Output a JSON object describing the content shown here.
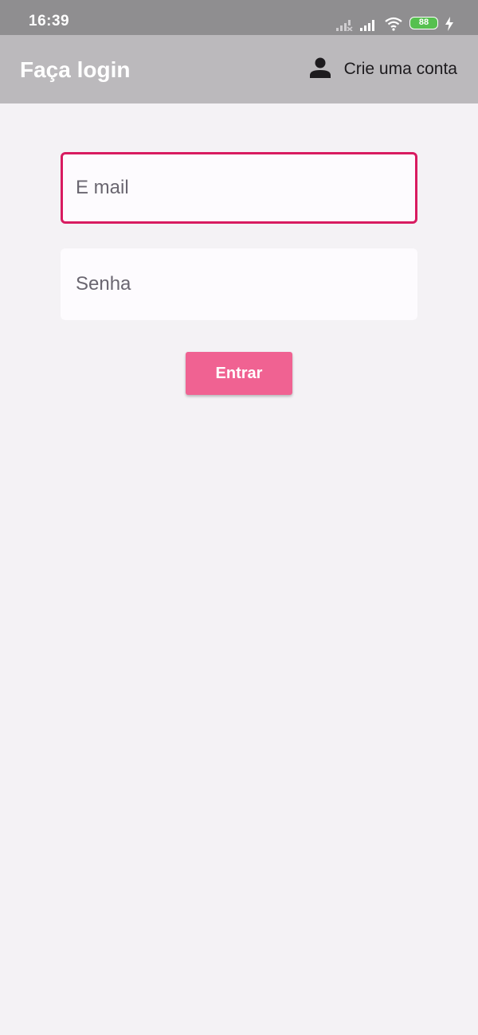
{
  "status_bar": {
    "time": "16:39",
    "battery": "88",
    "icons": [
      "signal-off-icon",
      "signal-icon",
      "wifi-icon",
      "battery-icon",
      "charging-icon"
    ]
  },
  "app_bar": {
    "title": "Faça login",
    "create_account_label": "Crie uma conta",
    "create_account_icon": "person-icon"
  },
  "form": {
    "email_placeholder": "E mail",
    "email_value": "",
    "password_placeholder": "Senha",
    "password_value": "",
    "login_label": "Entrar"
  },
  "colors": {
    "status_bar": "#8f8e90",
    "app_bar": "#bbb9bc",
    "background": "#f4f2f5",
    "focus_border": "#d81b60",
    "button": "#f06292",
    "battery": "#56c04f"
  }
}
